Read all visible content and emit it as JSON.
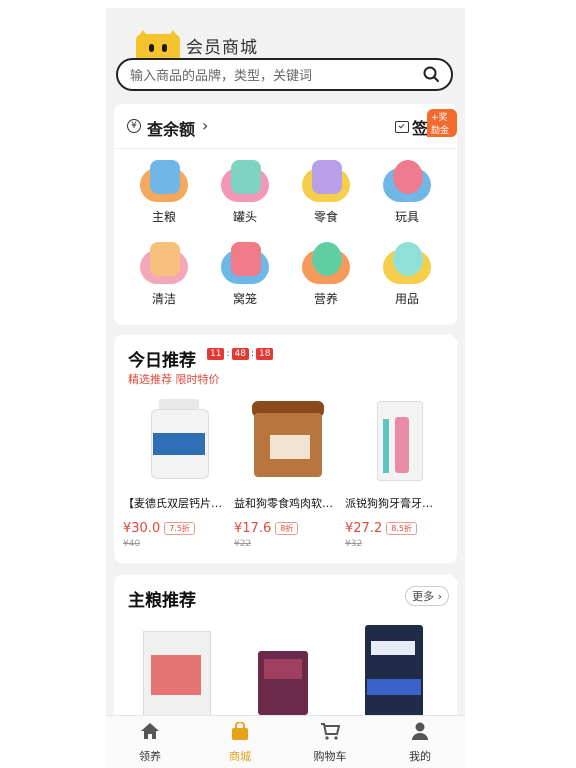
{
  "header": {
    "title": "会员商城",
    "search_placeholder": "输入商品的品牌，类型，关键词"
  },
  "balance": {
    "currency_symbol": "¥",
    "label": "查余额",
    "chevron": "›",
    "signin_label": "签到",
    "reward_badge": "+奖励金"
  },
  "categories": [
    {
      "label": "主粮",
      "icon": "food-bowl-icon",
      "color": "#6fb7e6"
    },
    {
      "label": "罐头",
      "icon": "paw-can-icon",
      "color": "#7fd3c3"
    },
    {
      "label": "零食",
      "icon": "snack-bag-icon",
      "color": "#b99ee8"
    },
    {
      "label": "玩具",
      "icon": "yarn-ball-icon",
      "color": "#f07b8e"
    },
    {
      "label": "清洁",
      "icon": "comb-icon",
      "color": "#f6c07a"
    },
    {
      "label": "窝笼",
      "icon": "pet-house-icon",
      "color": "#f27b88"
    },
    {
      "label": "营养",
      "icon": "supplement-icon",
      "color": "#5fcfa3"
    },
    {
      "label": "用品",
      "icon": "health-cross-icon",
      "color": "#8fe0d8"
    }
  ],
  "today": {
    "title": "今日推荐",
    "timer": {
      "h": "11",
      "m": "48",
      "s": "18",
      "sep": ":"
    },
    "subtitle": "精选推荐 限时特价",
    "products": [
      {
        "name": "【麦德氏双层钙片…",
        "price": "¥30.0",
        "discount": "7.5折",
        "old_price": "¥40"
      },
      {
        "name": "益和狗零食鸡肉软…",
        "price": "¥17.6",
        "discount": "8折",
        "old_price": "¥22"
      },
      {
        "name": "派锐狗狗牙膏牙…",
        "price": "¥27.2",
        "discount": "8.5折",
        "old_price": "¥32"
      }
    ]
  },
  "main_food": {
    "title": "主粮推荐",
    "more_label": "更多 ›"
  },
  "tabbar": [
    {
      "label": "领养",
      "icon": "home-icon",
      "active": false
    },
    {
      "label": "商城",
      "icon": "shopping-bag-icon",
      "active": true
    },
    {
      "label": "购物车",
      "icon": "cart-icon",
      "active": false
    },
    {
      "label": "我的",
      "icon": "user-icon",
      "active": false
    }
  ],
  "colors": {
    "accent": "#e7a21a",
    "price_red": "#e04a3b",
    "brand_yellow": "#f4c430"
  }
}
